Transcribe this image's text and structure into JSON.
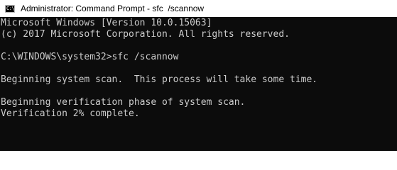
{
  "window": {
    "title": "Administrator: Command Prompt - sfc  /scannow",
    "icon": "cmd-icon",
    "icon_glyph": "C:\\",
    "background_color": "#0c0c0c",
    "text_color": "#cccccc"
  },
  "console": {
    "lines": [
      "Microsoft Windows [Version 10.0.15063]",
      "(c) 2017 Microsoft Corporation. All rights reserved.",
      "",
      "C:\\WINDOWS\\system32>sfc /scannow",
      "",
      "Beginning system scan.  This process will take some time.",
      "",
      "Beginning verification phase of system scan.",
      "Verification 2% complete."
    ]
  }
}
